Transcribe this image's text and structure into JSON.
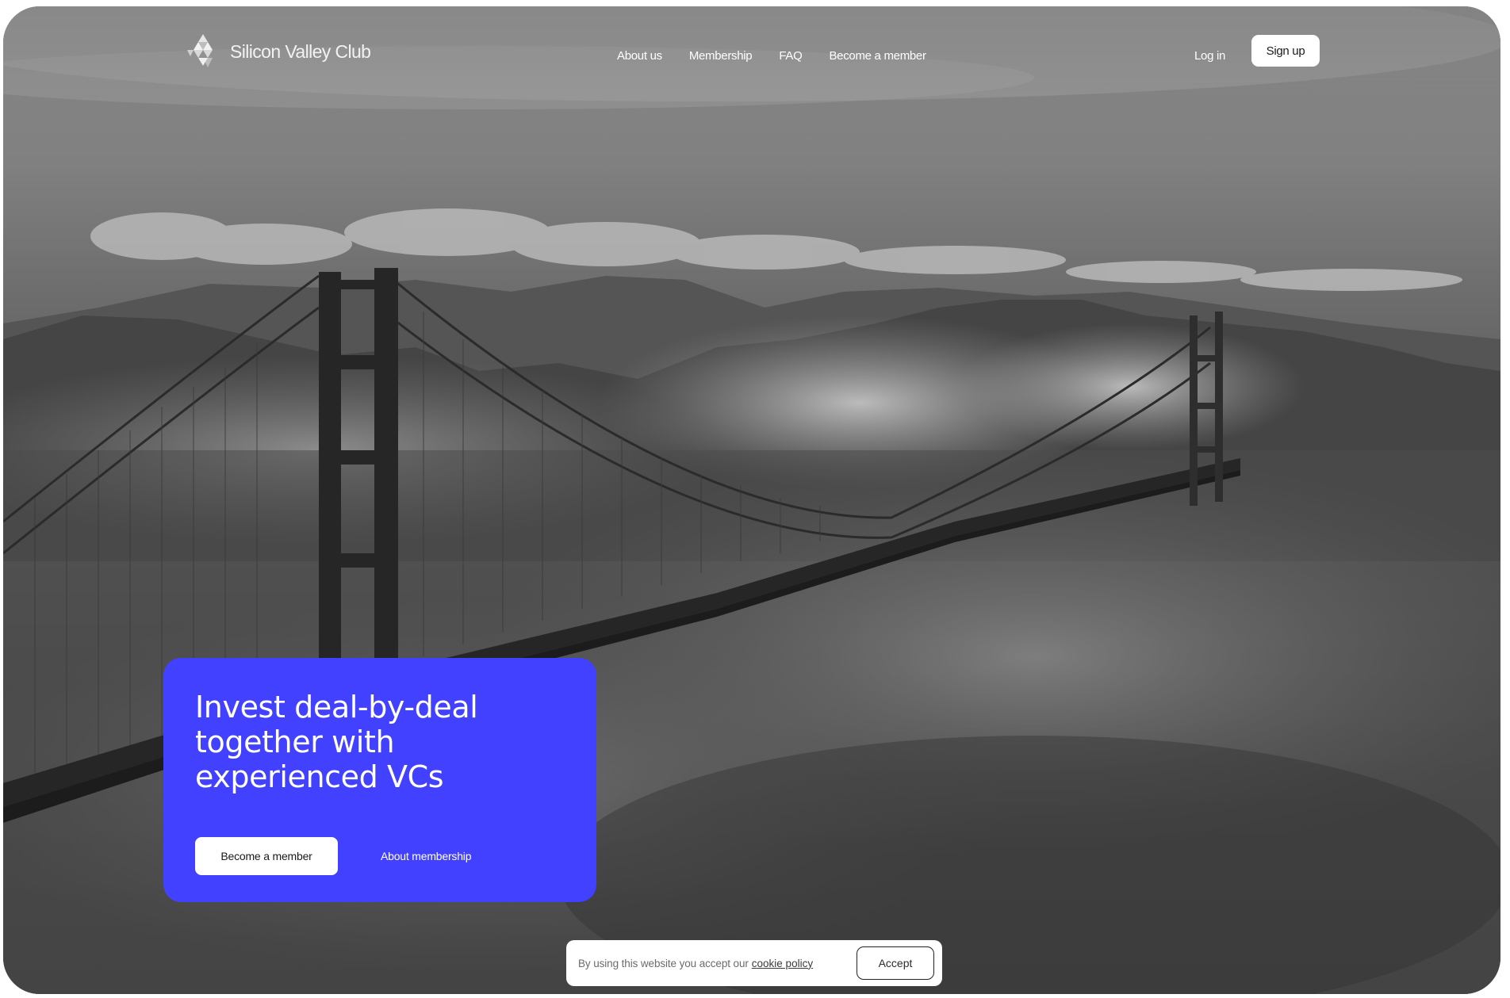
{
  "brand": {
    "name": "Silicon Valley Club",
    "logo_icon": "triangle-cluster-logo"
  },
  "nav": {
    "items": [
      {
        "label": "About us"
      },
      {
        "label": "Membership"
      },
      {
        "label": "FAQ"
      },
      {
        "label": "Become a member"
      }
    ],
    "login_label": "Log in",
    "signup_label": "Sign up"
  },
  "hero": {
    "title": "Invest deal-by-deal together with experienced VCs",
    "primary_cta": "Become a member",
    "secondary_cta": "About membership",
    "background_image": "golden-gate-bridge-fog-grayscale",
    "card_color": "#4141FF"
  },
  "cookie_banner": {
    "text": "By using this website you accept our",
    "link_label": "cookie policy",
    "accept_label": "Accept"
  }
}
